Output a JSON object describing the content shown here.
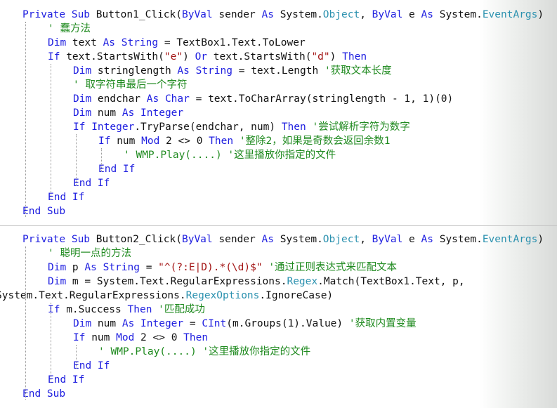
{
  "colors": {
    "keyword": "#2020e0",
    "comment": "#1f8a1f",
    "type": "#2b91af",
    "string": "#a31515",
    "text": "#111111",
    "background": "#ffffff"
  },
  "code": {
    "lines": [
      [
        [
          "k",
          "Private Sub "
        ],
        [
          "p",
          "Button1_Click("
        ],
        [
          "k",
          "ByVal "
        ],
        [
          "p",
          "sender "
        ],
        [
          "k",
          "As "
        ],
        [
          "p",
          "System."
        ],
        [
          "t",
          "Object"
        ],
        [
          "p",
          ", "
        ],
        [
          "k",
          "ByVal "
        ],
        [
          "p",
          "e "
        ],
        [
          "k",
          "As "
        ],
        [
          "p",
          "System."
        ],
        [
          "t",
          "EventArgs"
        ],
        [
          "p",
          ")"
        ]
      ],
      [
        [
          "c",
          "' 蠢方法"
        ]
      ],
      [
        [
          "k",
          "Dim "
        ],
        [
          "p",
          "text "
        ],
        [
          "k",
          "As String "
        ],
        [
          "p",
          "= TextBox1.Text.ToLower"
        ]
      ],
      [
        [
          "k",
          "If "
        ],
        [
          "p",
          "text.StartsWith("
        ],
        [
          "s",
          "\"e\""
        ],
        [
          "p",
          ") "
        ],
        [
          "k",
          "Or "
        ],
        [
          "p",
          "text.StartsWith("
        ],
        [
          "s",
          "\"d\""
        ],
        [
          "p",
          ") "
        ],
        [
          "k",
          "Then"
        ]
      ],
      [
        [
          "k",
          "Dim "
        ],
        [
          "p",
          "stringlength "
        ],
        [
          "k",
          "As String "
        ],
        [
          "p",
          "= text.Length "
        ],
        [
          "c",
          "'获取文本长度"
        ]
      ],
      [
        [
          "c",
          "' 取字符串最后一个字符"
        ]
      ],
      [
        [
          "k",
          "Dim "
        ],
        [
          "p",
          "endchar "
        ],
        [
          "k",
          "As Char "
        ],
        [
          "p",
          "= text.ToCharArray(stringlength - 1, 1)(0)"
        ]
      ],
      [
        [
          "k",
          "Dim "
        ],
        [
          "p",
          "num "
        ],
        [
          "k",
          "As Integer"
        ]
      ],
      [
        [
          "k",
          "If Integer"
        ],
        [
          "p",
          ".TryParse(endchar, num) "
        ],
        [
          "k",
          "Then "
        ],
        [
          "c",
          "'尝试解析字符为数字"
        ]
      ],
      [
        [
          "k",
          "If "
        ],
        [
          "p",
          "num "
        ],
        [
          "k",
          "Mod "
        ],
        [
          "p",
          "2 <> 0 "
        ],
        [
          "k",
          "Then "
        ],
        [
          "c",
          "'整除2，如果是奇数会返回余数1"
        ]
      ],
      [
        [
          "c",
          "' WMP.Play(....) '这里播放你指定的文件"
        ]
      ],
      [
        [
          "k",
          "End If"
        ]
      ],
      [
        [
          "k",
          "End If"
        ]
      ],
      [
        [
          "k",
          "End If"
        ]
      ],
      [
        [
          "k",
          "End Sub"
        ]
      ],
      [
        [
          "p",
          ""
        ]
      ],
      [
        [
          "k",
          "Private Sub "
        ],
        [
          "p",
          "Button2_Click("
        ],
        [
          "k",
          "ByVal "
        ],
        [
          "p",
          "sender "
        ],
        [
          "k",
          "As "
        ],
        [
          "p",
          "System."
        ],
        [
          "t",
          "Object"
        ],
        [
          "p",
          ", "
        ],
        [
          "k",
          "ByVal "
        ],
        [
          "p",
          "e "
        ],
        [
          "k",
          "As "
        ],
        [
          "p",
          "System."
        ],
        [
          "t",
          "EventArgs"
        ],
        [
          "p",
          ")"
        ]
      ],
      [
        [
          "c",
          "' 聪明一点的方法"
        ]
      ],
      [
        [
          "k",
          "Dim "
        ],
        [
          "p",
          "p "
        ],
        [
          "k",
          "As String "
        ],
        [
          "p",
          "= "
        ],
        [
          "s",
          "\"^(?:E|D).*(\\d)$\" "
        ],
        [
          "c",
          "'通过正则表达式来匹配文本"
        ]
      ],
      [
        [
          "k",
          "Dim "
        ],
        [
          "p",
          "m = System.Text.RegularExpressions."
        ],
        [
          "t",
          "Regex"
        ],
        [
          "p",
          ".Match(TextBox1.Text, p,"
        ]
      ],
      [
        [
          "p",
          "System.Text.RegularExpressions."
        ],
        [
          "t",
          "RegexOptions"
        ],
        [
          "p",
          ".IgnoreCase)"
        ]
      ],
      [
        [
          "k",
          "If "
        ],
        [
          "p",
          "m.Success "
        ],
        [
          "k",
          "Then "
        ],
        [
          "c",
          "'匹配成功"
        ]
      ],
      [
        [
          "k",
          "Dim "
        ],
        [
          "p",
          "num "
        ],
        [
          "k",
          "As Integer "
        ],
        [
          "p",
          "= "
        ],
        [
          "k",
          "CInt"
        ],
        [
          "p",
          "(m.Groups(1).Value) "
        ],
        [
          "c",
          "'获取内置变量"
        ]
      ],
      [
        [
          "k",
          "If "
        ],
        [
          "p",
          "num "
        ],
        [
          "k",
          "Mod "
        ],
        [
          "p",
          "2 <> 0 "
        ],
        [
          "k",
          "Then"
        ]
      ],
      [
        [
          "c",
          "' WMP.Play(....) '这里播放你指定的文件"
        ]
      ],
      [
        [
          "k",
          "End If"
        ]
      ],
      [
        [
          "k",
          "End If"
        ]
      ],
      [
        [
          "k",
          "End Sub"
        ]
      ]
    ]
  }
}
